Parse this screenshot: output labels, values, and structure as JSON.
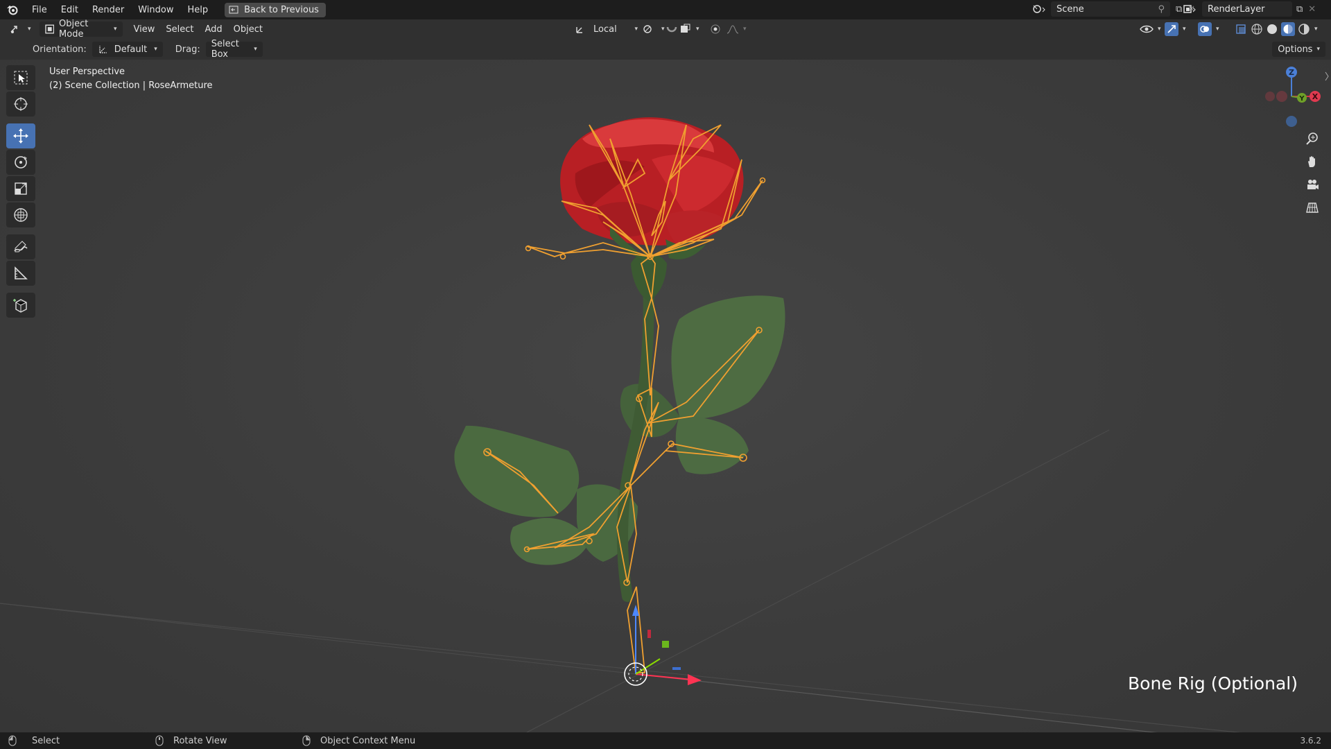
{
  "topbar": {
    "menu": [
      "File",
      "Edit",
      "Render",
      "Window",
      "Help"
    ],
    "back_button": "Back to Previous",
    "scene": "Scene",
    "render_layer": "RenderLayer"
  },
  "header": {
    "mode": "Object Mode",
    "menus": [
      "View",
      "Select",
      "Add",
      "Object"
    ],
    "transform_orientation": "Local"
  },
  "tool_settings": {
    "orientation_label": "Orientation:",
    "orientation_value": "Default",
    "drag_label": "Drag:",
    "drag_value": "Select Box",
    "options_label": "Options"
  },
  "viewport": {
    "view_name": "User Perspective",
    "collection_info": "(2) Scene Collection | RoseArmeture",
    "caption": "Bone Rig (Optional)",
    "gizmo_labels": {
      "z": "Z",
      "y": "Y",
      "x": "X"
    }
  },
  "statusbar": {
    "select": "Select",
    "rotate": "Rotate View",
    "context": "Object Context Menu",
    "version": "3.6.2"
  },
  "colors": {
    "accent": "#4772b3",
    "bone": "#f0a030",
    "rose": "#c8262a",
    "leaf": "#4d6a3f"
  }
}
